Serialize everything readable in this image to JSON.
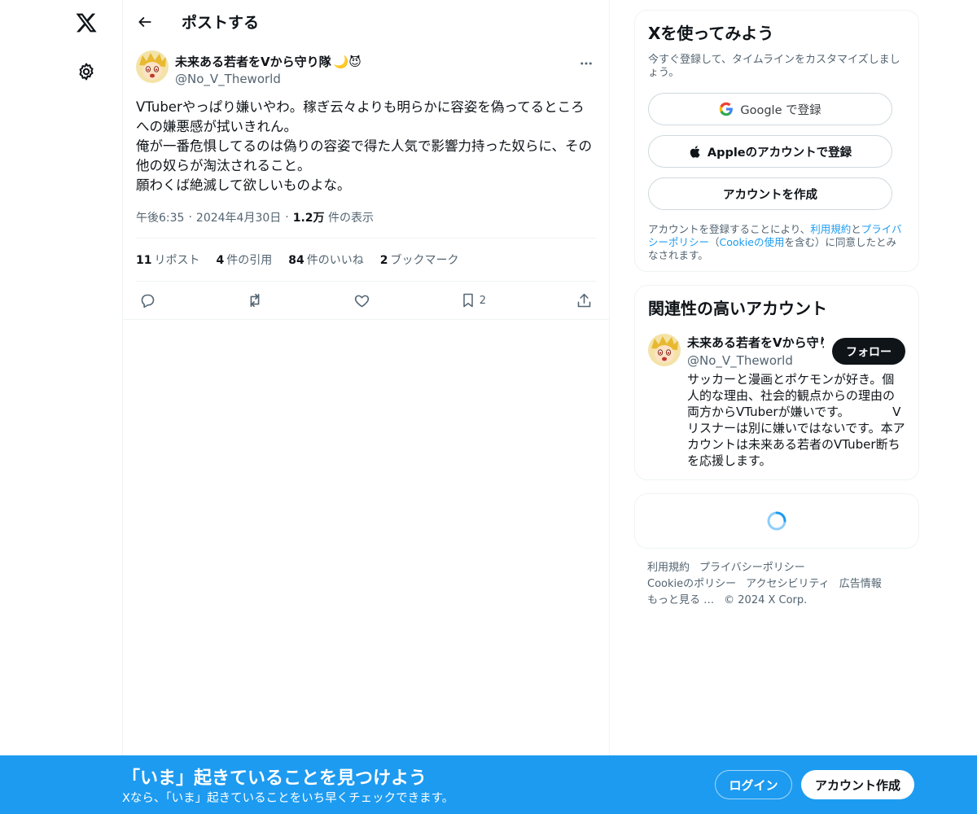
{
  "header": {
    "title": "ポストする"
  },
  "post": {
    "author_name": "未来ある若者をVから守り隊",
    "author_emoji": "🌙😈",
    "author_handle": "@No_V_Theworld",
    "body": "VTuberやっぱり嫌いやわ。稼ぎ云々よりも明らかに容姿を偽ってるところへの嫌悪感が拭いきれん。\n俺が一番危惧してるのは偽りの容姿で得た人気で影響力持った奴らに、その他の奴らが淘汰されること。\n願わくば絶滅して欲しいものよな。",
    "time": "午後6:35",
    "date": "2024年4月30日",
    "views_count": "1.2万",
    "views_label": "件の表示",
    "separator": "·"
  },
  "stats": [
    {
      "count": "11",
      "label": "リポスト"
    },
    {
      "count": "4",
      "label": "件の引用"
    },
    {
      "count": "84",
      "label": "件のいいね"
    },
    {
      "count": "2",
      "label": "ブックマーク"
    }
  ],
  "actions": {
    "bookmark_count": "2"
  },
  "signup_card": {
    "title": "Xを使ってみよう",
    "subtitle": "今すぐ登録して、タイムラインをカスタマイズしましょう。",
    "google_label": "Google で登録",
    "apple_label": "Appleのアカウントで登録",
    "create_label": "アカウントを作成",
    "terms_pre": "アカウントを登録することにより、",
    "terms_link1": "利用規約",
    "terms_and": "と",
    "terms_link2": "プライバシーポリシー",
    "terms_paren_open": "（",
    "terms_link3": "Cookieの使用",
    "terms_post": "を含む）に同意したとみなされます。"
  },
  "related": {
    "title": "関連性の高いアカウント",
    "name": "未来ある若者をVから守り隊",
    "handle": "@No_V_Theworld",
    "follow_label": "フォロー",
    "bio": "サッカーと漫画とポケモンが好き。個人的な理由、社会的観点からの理由の両方からVTuberが嫌いです。　　　　Vリスナーは別に嫌いではないです。本アカウントは未来ある若者のVTuber断ちを応援します。"
  },
  "footer": {
    "links": [
      "利用規約",
      "プライバシーポリシー",
      "Cookieのポリシー",
      "アクセシビリティ",
      "広告情報",
      "もっと見る …"
    ],
    "copyright": "© 2024 X Corp."
  },
  "bottombar": {
    "title": "「いま」起きていることを見つけよう",
    "subtitle": "Xなら、「いま」起きていることをいち早くチェックできます。",
    "login_label": "ログイン",
    "signup_label": "アカウント作成"
  },
  "colors": {
    "accent": "#1d9bf0",
    "text": "#0f1419",
    "muted": "#536471"
  }
}
